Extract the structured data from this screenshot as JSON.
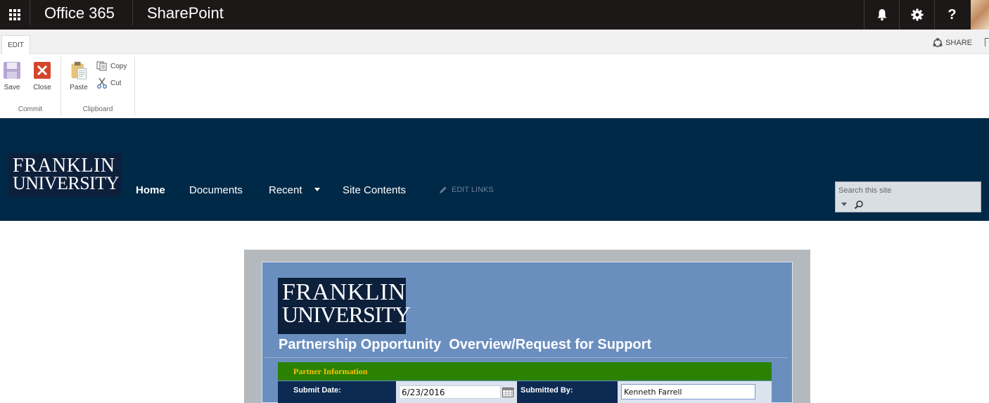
{
  "suitebar": {
    "brand": "Office 365",
    "app": "SharePoint",
    "icons": [
      "waffle-icon",
      "bell-icon",
      "gear-icon",
      "help-icon"
    ],
    "help_label": "?"
  },
  "ribbon": {
    "tab": "EDIT",
    "share": "SHARE",
    "commit": {
      "save": "Save",
      "close": "Close",
      "group": "Commit"
    },
    "clipboard": {
      "paste": "Paste",
      "copy": "Copy",
      "cut": "Cut",
      "group": "Clipboard"
    }
  },
  "site": {
    "logo_line1": "FRANKLIN",
    "logo_line2": "UNIVERSITY",
    "nav": [
      "Home",
      "Documents",
      "Recent",
      "Site Contents"
    ],
    "edit_links": "EDIT LINKS",
    "search_placeholder": "Search this site"
  },
  "form": {
    "logo_line1": "FRANKLIN",
    "logo_line2": "UNIVERSITY",
    "title": "Partnership Opportunity  Overview/Request for Support",
    "section": "Partner Information",
    "submit_date_label": "Submit Date:",
    "submit_date_value": "6/23/2016",
    "submitted_by_label": "Submitted By:",
    "submitted_by_value": "Kenneth Farrell"
  },
  "colors": {
    "suitebar": "#1c1818",
    "header": "#002947",
    "form_blue": "#6a8fbf",
    "section_green": "#2b8101",
    "section_text": "#f6c400",
    "label_navy": "#0c2a52"
  }
}
